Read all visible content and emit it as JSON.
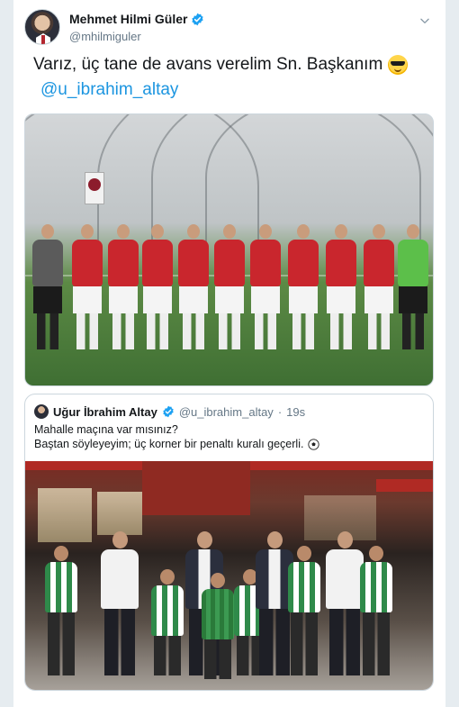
{
  "tweet": {
    "author": {
      "display_name": "Mehmet Hilmi Güler",
      "handle": "@mhilmiguler",
      "verified": true
    },
    "text": "Varız, üç tane de avans verelim Sn. Başkanım",
    "emoji": "smiling-face-with-sunglasses",
    "mention": "@u_ibrahim_altay",
    "menu_icon": "chevron-down-icon"
  },
  "quoted_tweet": {
    "author": {
      "display_name": "Uğur İbrahim Altay",
      "handle": "@u_ibrahim_altay",
      "verified": true
    },
    "separator": "·",
    "time": "19s",
    "text_line1": "Mahalle maçına var mısınız?",
    "text_line2": "Baştan söyleyeyim; üç korner bir penaltı kuralı geçerli.",
    "emoji": "soccer-ball"
  },
  "colors": {
    "link": "#1b95e0",
    "verified": "#1da1f2",
    "muted": "#657786",
    "border": "#ccd6dd"
  }
}
